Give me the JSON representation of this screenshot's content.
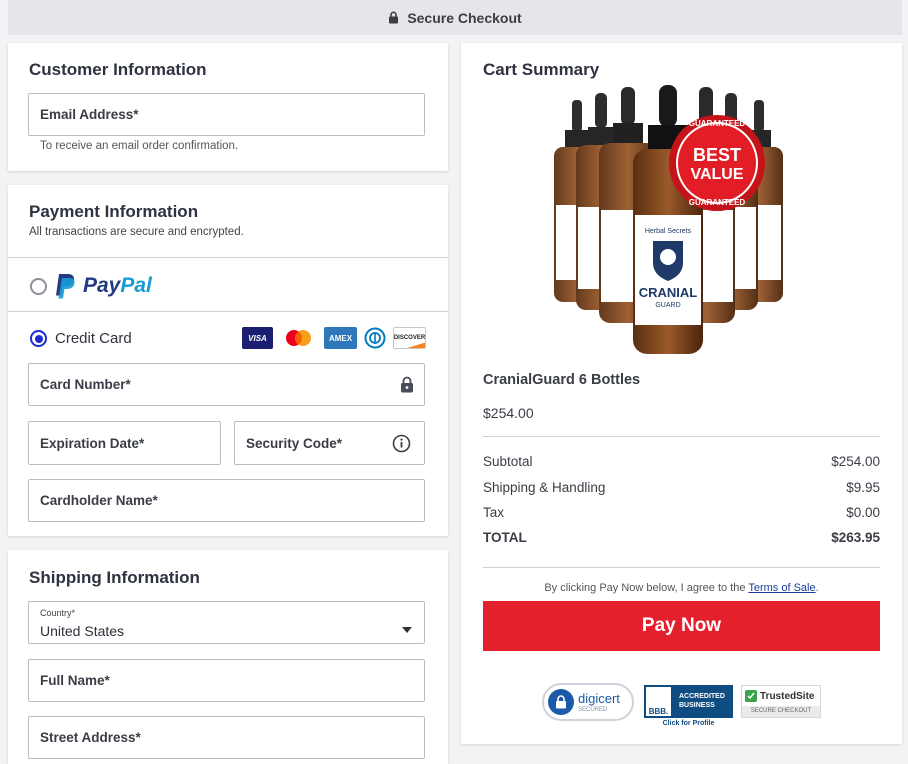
{
  "topbar": {
    "label": "Secure Checkout",
    "icon": "lock-icon"
  },
  "customer": {
    "title": "Customer Information",
    "email_placeholder": "Email Address*",
    "email_hint": "To receive an email order confirmation."
  },
  "payment": {
    "title": "Payment Information",
    "subtitle": "All transactions are secure and encrypted.",
    "paypal": {
      "pay": "Pay",
      "pal": "Pal",
      "selected": false
    },
    "credit_card": {
      "label": "Credit Card",
      "selected": true
    },
    "card_logos": [
      "VISA",
      "mastercard",
      "AMEX",
      "Diners",
      "DISCOVER"
    ],
    "card_number_placeholder": "Card Number*",
    "expiration_placeholder": "Expiration Date*",
    "security_placeholder": "Security Code*",
    "cardholder_placeholder": "Cardholder Name*"
  },
  "shipping": {
    "title": "Shipping Information",
    "country_label": "Country*",
    "country_value": "United States",
    "full_name_placeholder": "Full Name*",
    "street_placeholder": "Street Address*"
  },
  "cart": {
    "title": "Cart Summary",
    "product_label": "Herbal Secrets",
    "product_brand": "CRANIAL",
    "product_brand_sub": "GUARD",
    "seal_top": "GUARANTEED",
    "seal_main_1": "BEST",
    "seal_main_2": "VALUE",
    "seal_bottom": "GUARANTEED",
    "product_name": "CranialGuard 6 Bottles",
    "product_price": "$254.00",
    "rows": [
      {
        "label": "Subtotal",
        "value": "$254.00"
      },
      {
        "label": "Shipping & Handling",
        "value": "$9.95"
      },
      {
        "label": "Tax",
        "value": "$0.00"
      }
    ],
    "total": {
      "label": "TOTAL",
      "value": "$263.95"
    },
    "terms_prefix": "By clicking Pay Now below, I agree to the ",
    "terms_link": "Terms of Sale",
    "terms_suffix": ".",
    "pay_button": "Pay Now",
    "badges": {
      "digicert": "digicert",
      "digicert_sub": "SECURED",
      "bbb_line1": "ACCREDITED",
      "bbb_line2": "BUSINESS",
      "bbb_mark": "BBB.",
      "bbb_caption": "Click for Profile",
      "trusted": "TrustedSite",
      "trusted_sub": "SECURE CHECKOUT"
    }
  }
}
